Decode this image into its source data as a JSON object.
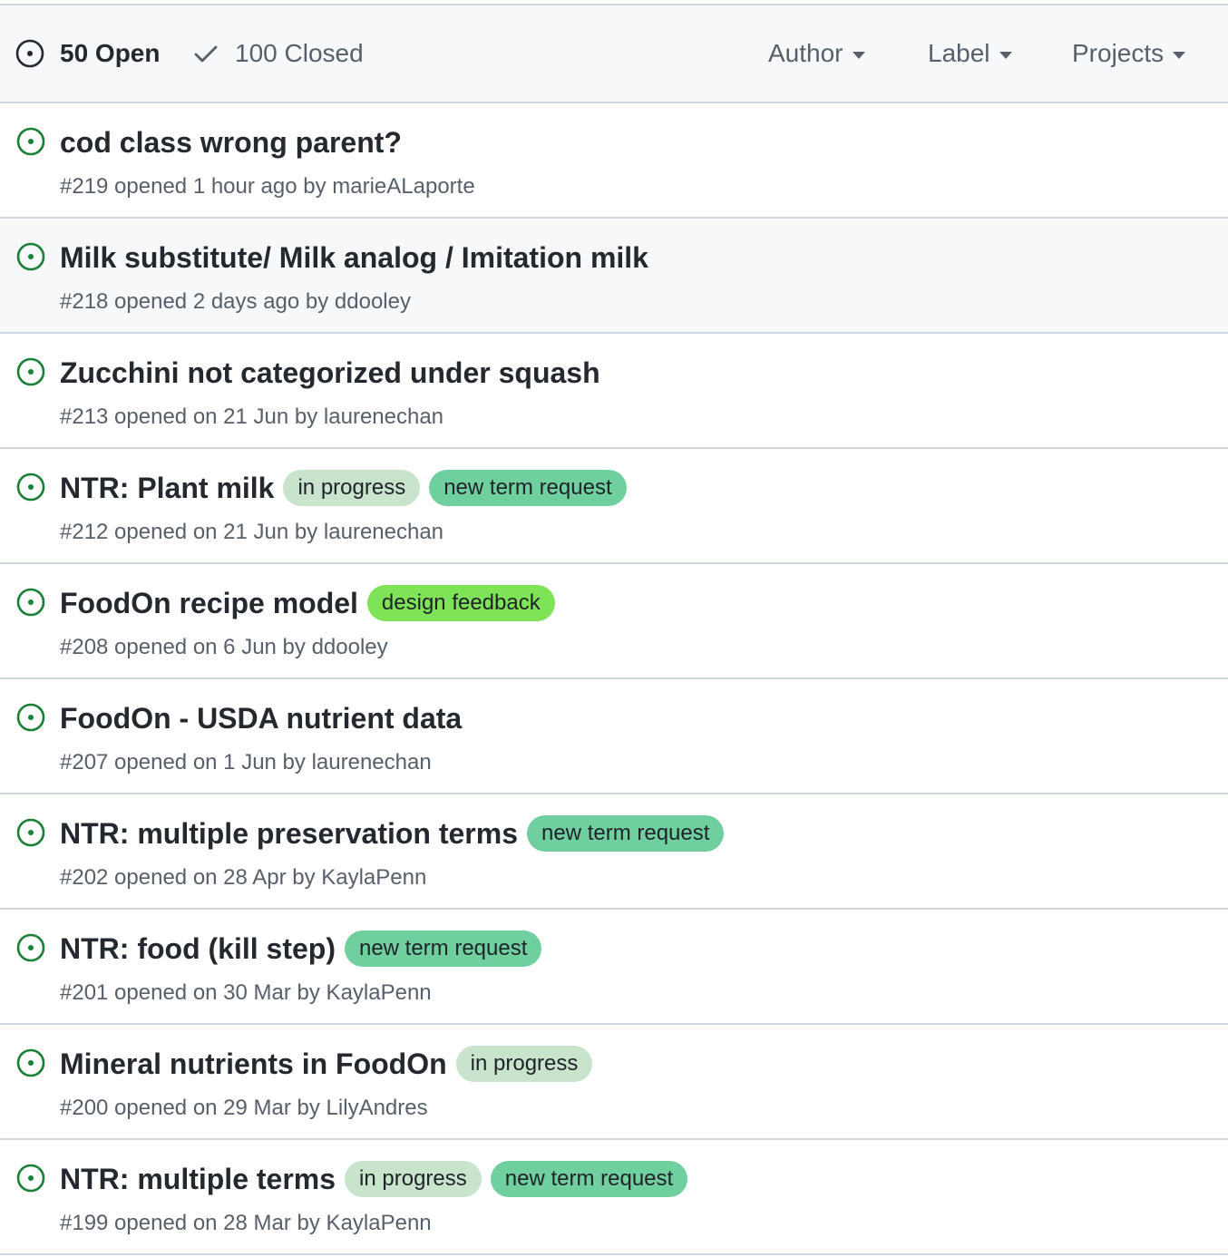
{
  "header": {
    "open_label": "50 Open",
    "closed_label": "100 Closed",
    "filters": {
      "author": "Author",
      "label": "Label",
      "projects": "Projects"
    }
  },
  "colors": {
    "open_icon": "#1a7f37",
    "label_in_progress": "#c9e4cc",
    "label_new_term_request": "#6fcf9f",
    "label_design_feedback": "#7ee356"
  },
  "issues": [
    {
      "title": "cod class wrong parent?",
      "meta": "#219 opened 1 hour ago by marieALaporte",
      "labels": []
    },
    {
      "title": "Milk substitute/ Milk analog / Imitation milk",
      "meta": "#218 opened 2 days ago by ddooley",
      "labels": []
    },
    {
      "title": "Zucchini not categorized under squash",
      "meta": "#213 opened on 21 Jun by laurenechan",
      "labels": []
    },
    {
      "title": "NTR: Plant milk",
      "meta": "#212 opened on 21 Jun by laurenechan",
      "labels": [
        "in progress",
        "new term request"
      ]
    },
    {
      "title": "FoodOn recipe model",
      "meta": "#208 opened on 6 Jun by ddooley",
      "labels": [
        "design feedback"
      ]
    },
    {
      "title": "FoodOn - USDA nutrient data",
      "meta": "#207 opened on 1 Jun by laurenechan",
      "labels": []
    },
    {
      "title": "NTR: multiple preservation terms",
      "meta": "#202 opened on 28 Apr by KaylaPenn",
      "labels": [
        "new term request"
      ]
    },
    {
      "title": "NTR: food (kill step)",
      "meta": "#201 opened on 30 Mar by KaylaPenn",
      "labels": [
        "new term request"
      ]
    },
    {
      "title": "Mineral nutrients in FoodOn",
      "meta": "#200 opened on 29 Mar by LilyAndres",
      "labels": [
        "in progress"
      ]
    },
    {
      "title": "NTR: multiple terms",
      "meta": "#199 opened on 28 Mar by KaylaPenn",
      "labels": [
        "in progress",
        "new term request"
      ]
    }
  ]
}
